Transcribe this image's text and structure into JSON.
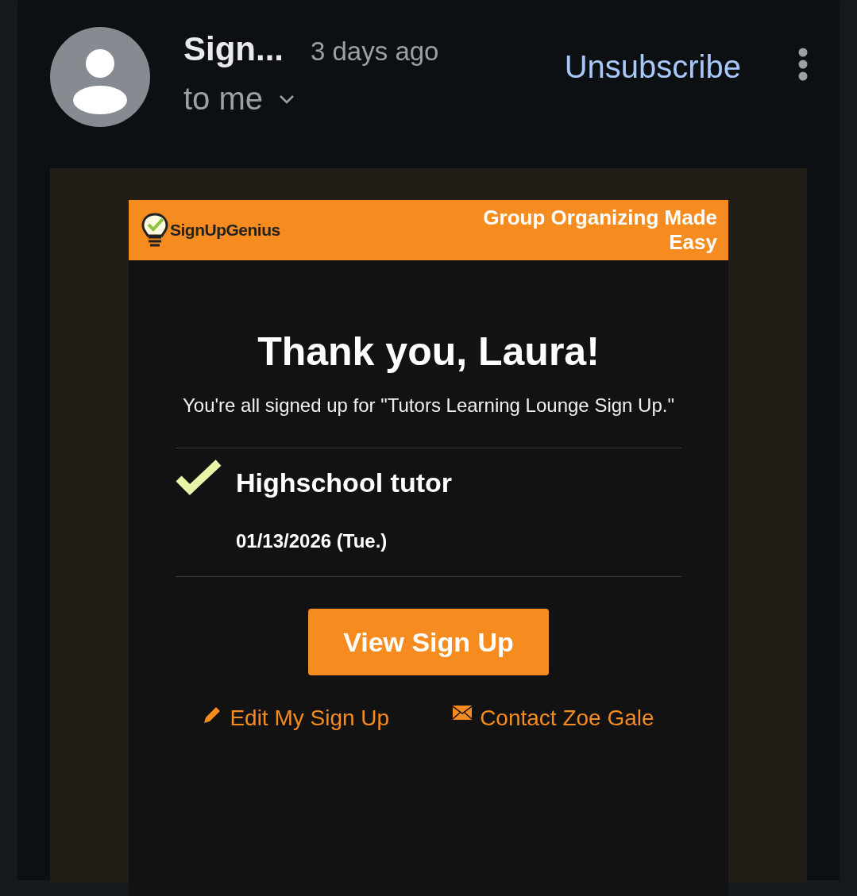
{
  "header": {
    "sender": "Sign...",
    "time": "3 days ago",
    "recipient": "to me",
    "unsubscribe": "Unsubscribe"
  },
  "email": {
    "brand": "SignUpGenius",
    "tagline": "Group Organizing Made Easy",
    "title": "Thank you, Laura!",
    "message": "You're all signed up for \"Tutors Learning Lounge Sign Up.\"",
    "slot": {
      "name": "Highschool tutor",
      "date": "01/13/2026 (Tue.)"
    },
    "button": "View Sign Up",
    "links": [
      {
        "kind": "pencil",
        "label": "Edit My Sign Up"
      },
      {
        "kind": "envelope",
        "label": "Contact Zoe Gale"
      }
    ]
  }
}
